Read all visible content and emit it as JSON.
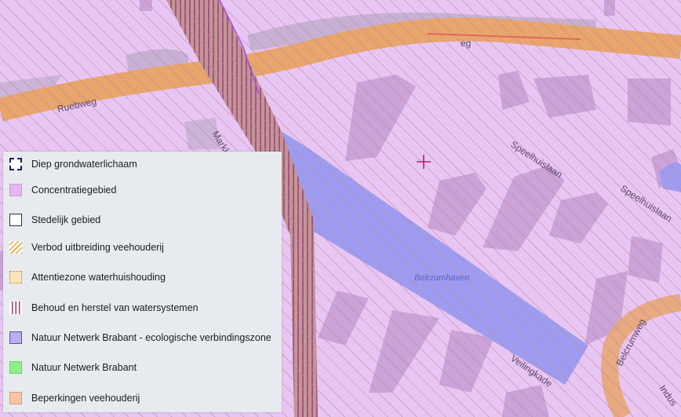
{
  "map": {
    "street_labels": {
      "ruebweg": "Ruebweg",
      "eg": "eg",
      "mark": "Markk",
      "speelhuislaan_1": "Speelhuislaan",
      "speelhuislaan_2": "Speelhuislaan",
      "belcrumweg": "Belcrumweg",
      "veilingkade": "Veilingkade",
      "indus": "Indus"
    },
    "water_label": "Belcrumhaven",
    "crosshair_icon": "crosshair-icon",
    "colors": {
      "concentratiegebied": "#e7c4f4",
      "hatch": "#c08aa0",
      "road": "#e8a56c",
      "water": "#9c9cf0",
      "building": "#c9a2d8",
      "crosshair": "#d0146a"
    }
  },
  "legend": {
    "items": [
      {
        "label": "Diep grondwaterlichaam",
        "icon": "dashed-square-icon"
      },
      {
        "label": "Concentratiegebied",
        "icon": "pink-square-icon"
      },
      {
        "label": "Stedelijk gebied",
        "icon": "outline-square-icon"
      },
      {
        "label": "Verbod uitbreiding veehouderij",
        "icon": "diagonal-hatch-icon"
      },
      {
        "label": "Attentiezone waterhuishouding",
        "icon": "dashed-orange-square-icon"
      },
      {
        "label": "Behoud en herstel van watersystemen",
        "icon": "vertical-lines-icon"
      },
      {
        "label": "Natuur Netwerk Brabant - ecologische verbindingszone",
        "icon": "purple-square-icon"
      },
      {
        "label": "Natuur Netwerk Brabant",
        "icon": "green-square-icon"
      },
      {
        "label": "Beperkingen veehouderij",
        "icon": "orange-square-icon"
      }
    ]
  }
}
